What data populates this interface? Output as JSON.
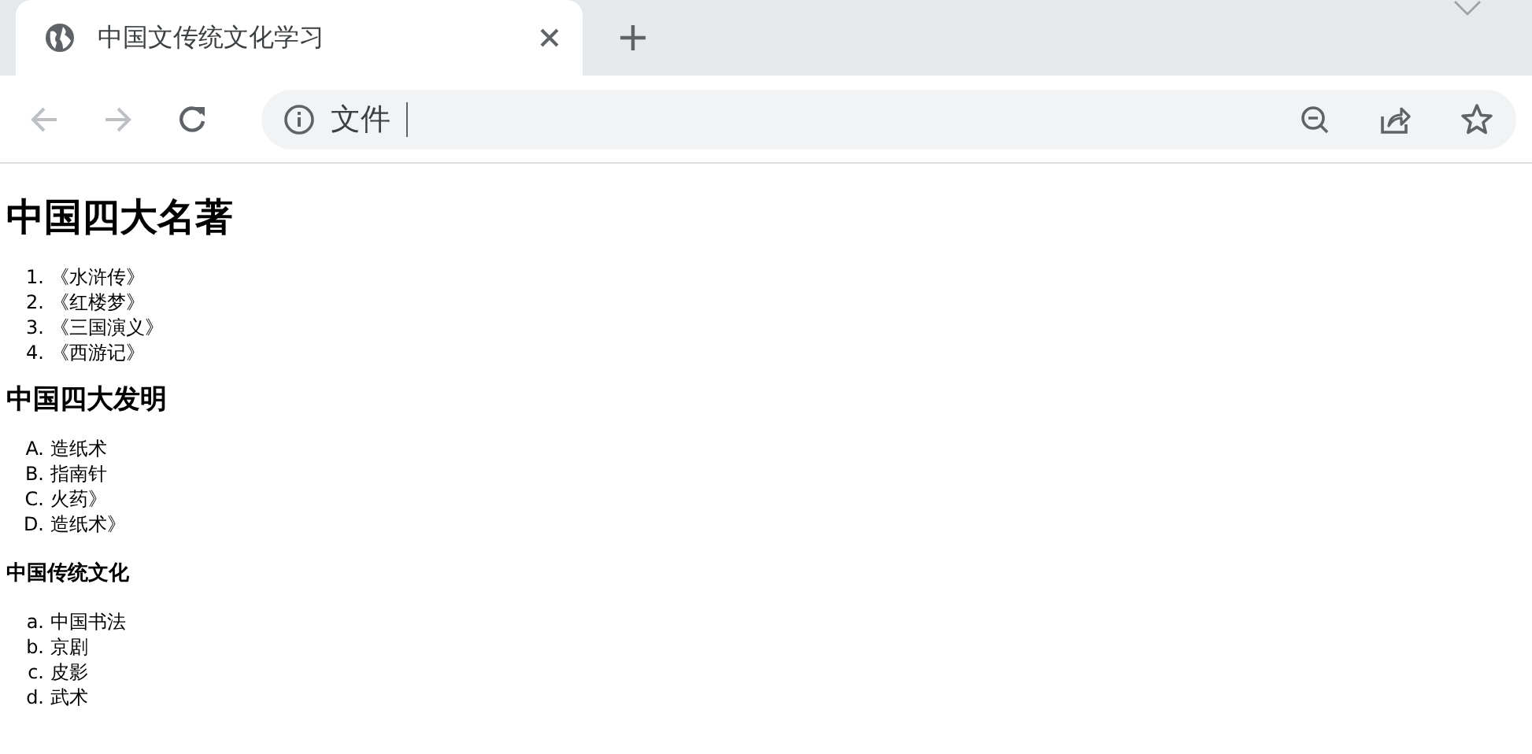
{
  "tab": {
    "title": "中国文传统文化学习",
    "selected": true
  },
  "address_bar": {
    "security_label": "文件"
  },
  "sections": [
    {
      "kind": "title",
      "heading": "中国四大名著",
      "items": [
        {
          "marker": "1.",
          "text": "《水浒传》"
        },
        {
          "marker": "2.",
          "text": "《红楼梦》"
        },
        {
          "marker": "3.",
          "text": "《三国演义》"
        },
        {
          "marker": "4.",
          "text": "《西游记》"
        }
      ]
    },
    {
      "kind": "heading",
      "heading": "中国四大发明",
      "items": [
        {
          "marker": "A.",
          "text": "造纸术"
        },
        {
          "marker": "B.",
          "text": "指南针"
        },
        {
          "marker": "C.",
          "text": "火药》"
        },
        {
          "marker": "D.",
          "text": "造纸术》"
        }
      ]
    },
    {
      "kind": "subheading",
      "heading": "中国传统文化",
      "items": [
        {
          "marker": "a.",
          "text": "中国书法"
        },
        {
          "marker": "b.",
          "text": "京剧"
        },
        {
          "marker": "c.",
          "text": "皮影"
        },
        {
          "marker": "d.",
          "text": "武术"
        }
      ]
    }
  ]
}
